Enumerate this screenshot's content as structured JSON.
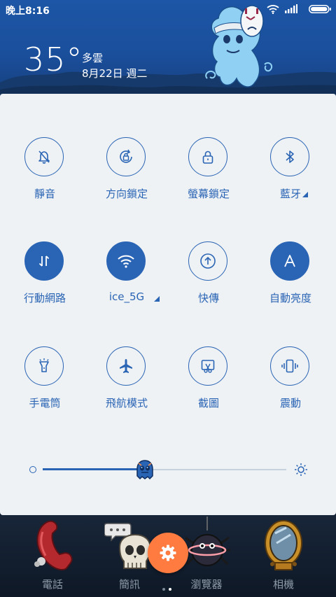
{
  "status_bar": {
    "time": "晚上8:16",
    "icons": [
      "wifi-icon",
      "signal-icon",
      "battery-icon"
    ]
  },
  "weather": {
    "temperature": "35°",
    "condition": "多雲",
    "date": "8月22日 週二"
  },
  "quick_settings": {
    "accent_color": "#2a64b4",
    "tiles": [
      {
        "label": "靜音",
        "icon": "bell-off-icon",
        "active": false
      },
      {
        "label": "方向鎖定",
        "icon": "rotation-lock-icon",
        "active": false
      },
      {
        "label": "螢幕鎖定",
        "icon": "padlock-icon",
        "active": false
      },
      {
        "label": "藍牙",
        "icon": "bluetooth-icon",
        "active": false,
        "has_menu": true
      },
      {
        "label": "行動網路",
        "icon": "mobile-data-icon",
        "active": true
      },
      {
        "label": "ice_5G",
        "icon": "wifi-icon",
        "active": true,
        "has_menu": true
      },
      {
        "label": "快傳",
        "icon": "upload-icon",
        "active": false
      },
      {
        "label": "自動亮度",
        "icon": "auto-brightness-icon",
        "active": true
      },
      {
        "label": "手電筒",
        "icon": "flashlight-icon",
        "active": false
      },
      {
        "label": "飛航模式",
        "icon": "airplane-icon",
        "active": false
      },
      {
        "label": "截圖",
        "icon": "screenshot-icon",
        "active": false
      },
      {
        "label": "震動",
        "icon": "vibrate-icon",
        "active": false
      }
    ],
    "brightness_level": 0.42
  },
  "dock": {
    "apps": [
      {
        "label": "電話",
        "icon": "phone-icon"
      },
      {
        "label": "簡訊",
        "icon": "messages-icon"
      },
      {
        "label": "瀏覽器",
        "icon": "browser-icon"
      },
      {
        "label": "相機",
        "icon": "camera-icon"
      }
    ],
    "settings_button_icon": "gear-icon",
    "page_indicator": {
      "pages": 2,
      "current": 2
    }
  }
}
